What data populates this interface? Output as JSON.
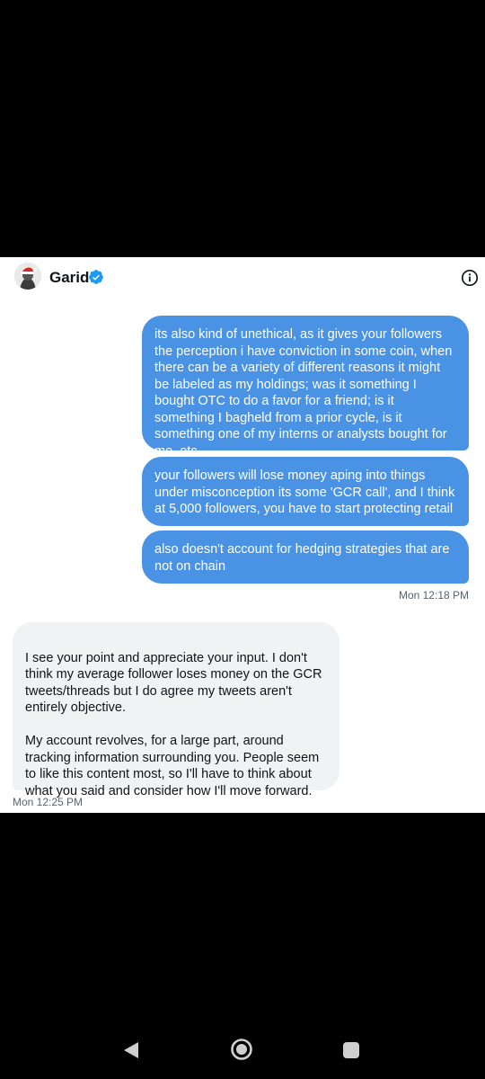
{
  "conversation": {
    "contact_name": "Garid",
    "verified": true
  },
  "messages": [
    {
      "from": "me",
      "text": "its also kind of unethical, as it gives your followers the perception i have conviction in some coin, when there can be a variety of different reasons it might be labeled as my holdings;  was it something I bought OTC to do a favor for a friend;  is it something I bagheld from a prior cycle, is it something one of my interns or analysts bought for me, etc"
    },
    {
      "from": "me",
      "text": "your followers will lose money aping into things under misconception its some 'GCR call', and I think at 5,000 followers, you have to start protecting retail"
    },
    {
      "from": "me",
      "text": "also doesn't account for hedging strategies that are not on chain"
    },
    {
      "from": "them",
      "text": "I see your point and appreciate your input. I don't think my average follower loses money on the GCR tweets/threads but I do agree my tweets aren't entirely objective.\n\nMy account revolves, for a large part, around tracking information surrounding you. People seem to like this content most, so I'll have to think about what you said and consider how I'll move forward."
    }
  ],
  "timestamps": {
    "sent_group": "Mon 12:18 PM",
    "received": "Mon 12:25 PM"
  },
  "colors": {
    "sent_bubble": "#4a93e4",
    "received_bubble": "#eff3f4",
    "verified": "#1d9bf0"
  },
  "icons": {
    "verified": "verified-badge-icon",
    "info": "info-icon",
    "nav_back": "back-triangle-icon",
    "nav_home": "home-circle-icon",
    "nav_recents": "recents-square-icon"
  }
}
